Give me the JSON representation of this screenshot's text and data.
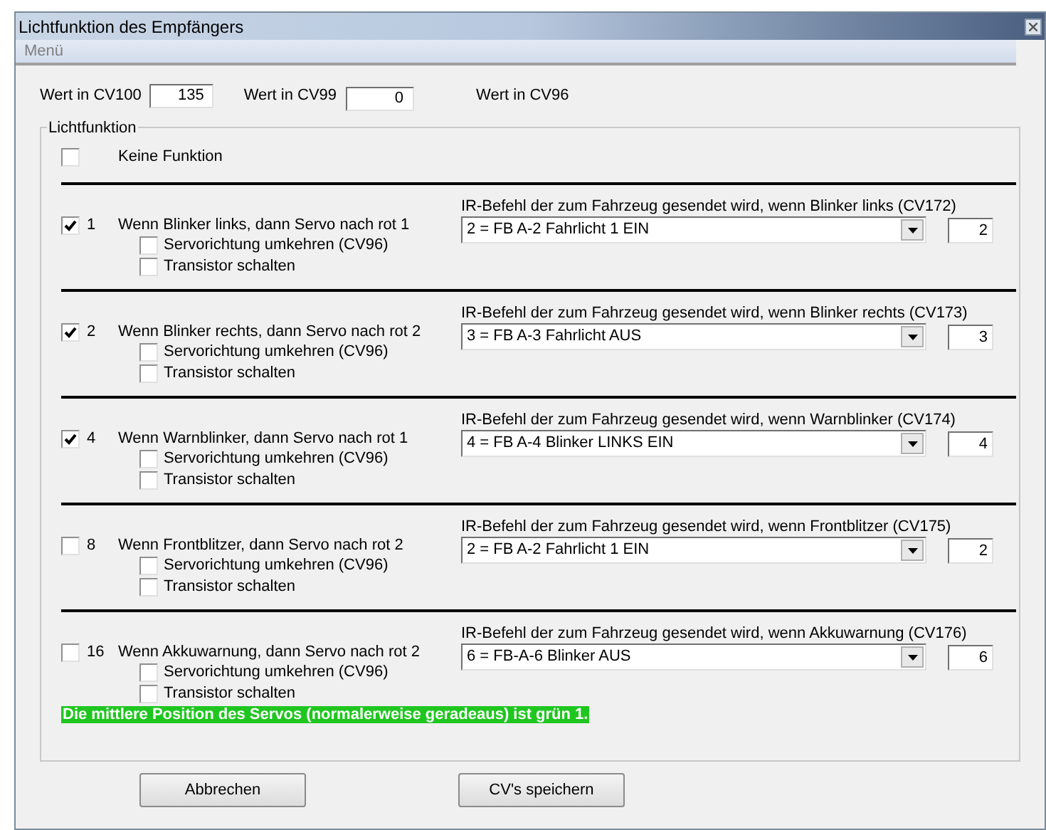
{
  "window": {
    "title": "Lichtfunktion des Empfängers"
  },
  "menu": [
    "Menü"
  ],
  "cv_fields": [
    {
      "label": "Wert in CV100",
      "value": "135"
    },
    {
      "label": "Wert in CV99",
      "value": "0"
    }
  ],
  "cv96_label": "Wert in CV96",
  "group": {
    "title": "Lichtfunktion",
    "none_option": {
      "label": "Keine Funktion",
      "checked": false
    }
  },
  "functions": [
    {
      "checked": true,
      "number": "1",
      "text": "Wenn Blinker links, dann Servo nach rot 1",
      "options": [
        {
          "label": "Servorichtung umkehren (CV96)",
          "checked": false
        },
        {
          "label": "Transistor schalten",
          "checked": false
        }
      ],
      "ir_label": "IR-Befehl der zum Fahrzeug gesendet wird, wenn Blinker links  (CV172)",
      "select_value": "2 = FB A-2 Fahrlicht 1 EIN",
      "value": "2"
    },
    {
      "checked": true,
      "number": "2",
      "text": "Wenn Blinker rechts, dann Servo nach rot 2",
      "options": [
        {
          "label": "Servorichtung umkehren (CV96)",
          "checked": false
        },
        {
          "label": "Transistor schalten",
          "checked": false
        }
      ],
      "ir_label": "IR-Befehl der zum Fahrzeug gesendet wird, wenn Blinker rechts  (CV173)",
      "select_value": "3 = FB A-3 Fahrlicht AUS",
      "value": "3"
    },
    {
      "checked": true,
      "number": "4",
      "text": "Wenn Warnblinker, dann Servo nach rot 1",
      "options": [
        {
          "label": "Servorichtung umkehren (CV96)",
          "checked": false
        },
        {
          "label": "Transistor schalten",
          "checked": false
        }
      ],
      "ir_label": "IR-Befehl der zum Fahrzeug gesendet wird, wenn Warnblinker  (CV174)",
      "select_value": "4 = FB A-4 Blinker LINKS EIN",
      "value": "4"
    },
    {
      "checked": false,
      "number": "8",
      "text": "Wenn Frontblitzer, dann Servo nach rot 2",
      "options": [
        {
          "label": "Servorichtung umkehren (CV96)",
          "checked": false
        },
        {
          "label": "Transistor schalten",
          "checked": false
        }
      ],
      "ir_label": "IR-Befehl der zum Fahrzeug gesendet wird, wenn Frontblitzer  (CV175)",
      "select_value": "2 = FB A-2 Fahrlicht 1 EIN",
      "value": "2"
    },
    {
      "checked": false,
      "number": "16",
      "text": "Wenn Akkuwarnung, dann Servo nach rot 2",
      "options": [
        {
          "label": "Servorichtung umkehren (CV96)",
          "checked": false
        },
        {
          "label": "Transistor schalten",
          "checked": false
        }
      ],
      "ir_label": "IR-Befehl der zum Fahrzeug gesendet wird, wenn Akkuwarnung  (CV176)",
      "select_value": "6 = FB-A-6 Blinker AUS",
      "value": "6"
    }
  ],
  "note": "Die mittlere Position des Servos (normalerweise geradeaus) ist grün 1.",
  "buttons": [
    "Abbrechen",
    "CV's speichern"
  ]
}
